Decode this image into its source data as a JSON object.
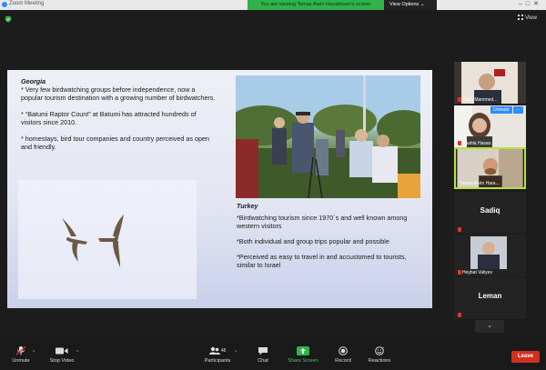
{
  "window": {
    "app_title": "Zoom Meeting"
  },
  "share_banner": {
    "viewing_text": "You are viewing Tomas Axén Haraldsson's screen",
    "view_options": "View Options ⌄"
  },
  "view_button": {
    "label": "View"
  },
  "slide": {
    "georgia": {
      "heading": "Georgia",
      "points": [
        "* Very few birdwatching groups before independence, now a popular tourism destination with a growing number of birdwatchers.",
        "* “Batumi Raptor Count” at Batumi has attracted hundreds of visitors since 2010.",
        "* homestays, bird tour companies and country perceived as open and friendly."
      ]
    },
    "turkey": {
      "heading": "Turkey",
      "points": [
        "*Birdwatching tourism since 1970´s and well known among western visitors",
        "*Both individual and group trips popular and possible",
        "*Perceived as easy to travel in and accustomed to tourists, similar to Israel"
      ]
    }
  },
  "participants": [
    {
      "name": "Taleh Mammed...",
      "muted": true,
      "video": true
    },
    {
      "name": "Shahla Hasan...",
      "muted": true,
      "video": true
    },
    {
      "name": "Tomas Axén Hara...",
      "muted": false,
      "video": true,
      "active": true
    },
    {
      "name": "Sadiq",
      "muted": true,
      "video": false
    },
    {
      "name": "Heybat Valiyev",
      "muted": true,
      "video": true
    },
    {
      "name": "Leman",
      "muted": true,
      "video": false
    }
  ],
  "participant_popup": {
    "unmute": "Unmute",
    "more": "···"
  },
  "toolbar": {
    "unmute": "Unmute",
    "stop_video": "Stop Video",
    "participants": "Participants",
    "participants_count": "48",
    "chat": "Chat",
    "share_screen": "Share Screen",
    "record": "Record",
    "reactions": "Reactions",
    "leave": "Leave"
  }
}
